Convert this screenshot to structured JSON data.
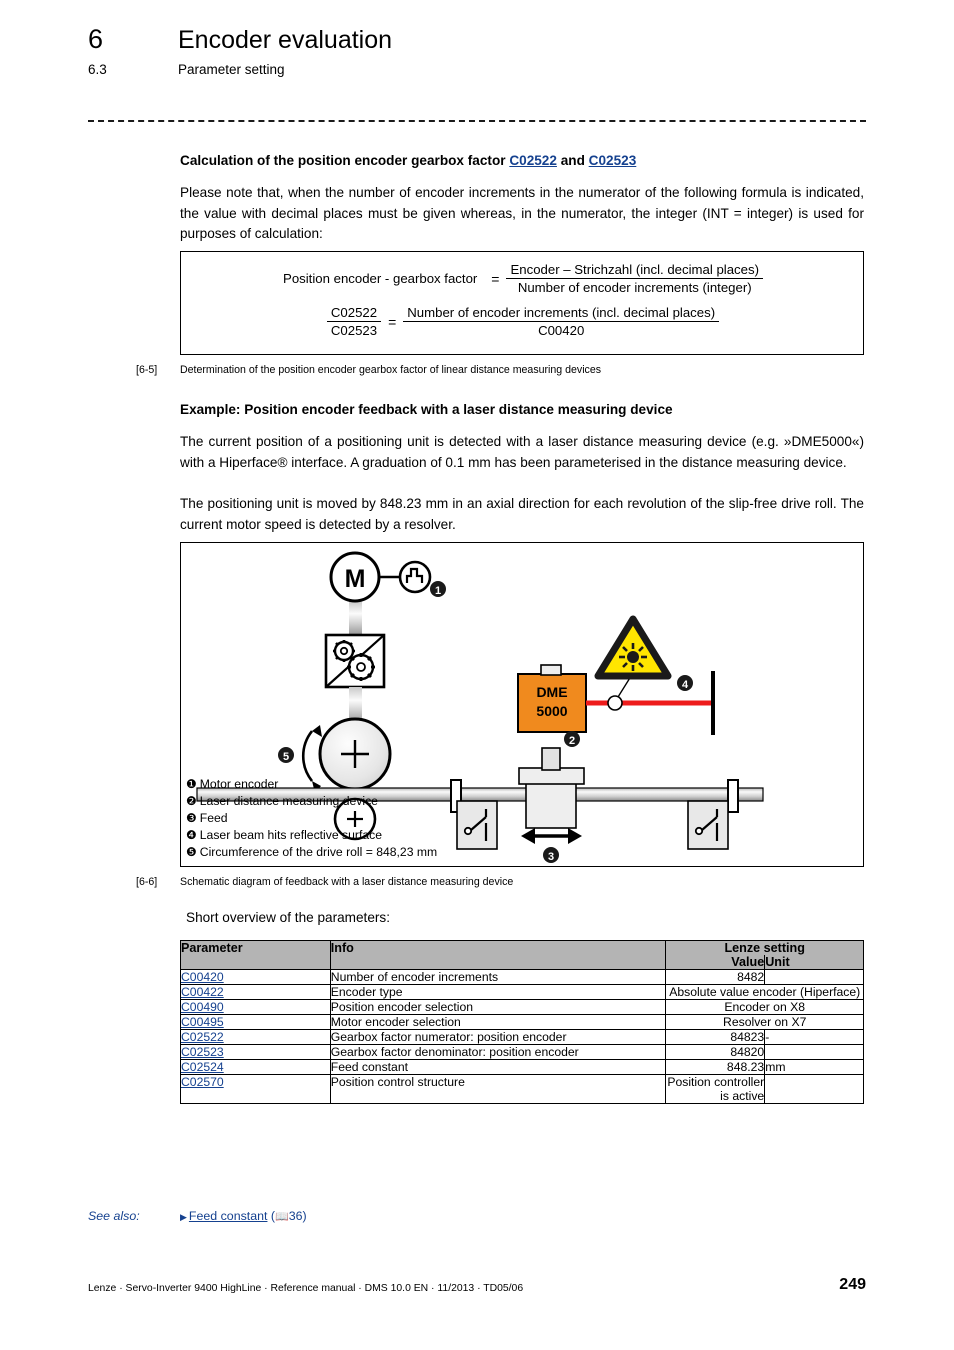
{
  "header": {
    "chapter_number": "6",
    "chapter_title": "Encoder evaluation",
    "section_number": "6.3",
    "section_title": "Parameter setting"
  },
  "section_heading": {
    "prefix": "Calculation of the position encoder gearbox factor ",
    "link1": "C02522",
    "middle": " and ",
    "link2": "C02523"
  },
  "intro_paragraph": "Please note that, when the number of encoder increments in the numerator of the following formula is indicated, the value with decimal places must be given whereas, in the numerator, the integer (INT = integer) is used for purposes of calculation:",
  "formula": {
    "line1_label": "Position encoder - gearbox factor",
    "line1_eq": "=",
    "line1_numerator": "Encoder – Strichzahl (incl. decimal places)",
    "line1_denominator": "Number of encoder increments (integer)",
    "line2_left_numerator": "C02522",
    "line2_left_denominator": "C02523",
    "line2_eq": "=",
    "line2_right_numerator": "Number of encoder increments (incl. decimal places)",
    "line2_right_denominator": "C00420"
  },
  "figure_6_5": {
    "number": "[6-5]",
    "caption": "Determination of the position encoder gearbox factor of linear distance measuring devices"
  },
  "example": {
    "heading": "Example: Position encoder feedback with a laser distance measuring device",
    "paragraph1": "The current position of a positioning unit is detected with a laser distance measuring device (e.g. »DME5000«) with a Hiperface® interface. A graduation of 0.1 mm has been parameterised in the distance measuring device.",
    "paragraph2": "The positioning unit is moved by 848.23 mm in an axial direction for each revolution of the slip-free drive roll. The current motor speed is detected by a resolver."
  },
  "diagram": {
    "motor_label": "M",
    "device_label_line1": "DME",
    "device_label_line2": "5000",
    "callouts": [
      "1",
      "2",
      "3",
      "4",
      "5"
    ],
    "colors": {
      "device_orange": "#f08a1e",
      "warning_yellow": "#ffe600",
      "laser_red": "#ee1c1c",
      "metal_grey": "#e8e8e8"
    }
  },
  "figure_6_6": {
    "number": "[6-6]",
    "caption": "Schematic diagram of feedback with a laser distance measuring device"
  },
  "legend": [
    {
      "bullet": "❶",
      "text": "Motor encoder"
    },
    {
      "bullet": "❷",
      "text": "Laser distance measuring device"
    },
    {
      "bullet": "❸",
      "text": "Feed"
    },
    {
      "bullet": "❹",
      "text": "Laser beam hits reflective surface"
    },
    {
      "bullet": "❺",
      "text": "Circumference of the drive roll = 848,23 mm"
    }
  ],
  "overview_label": "Short overview of the parameters:",
  "table": {
    "headers": {
      "parameter": "Parameter",
      "info": "Info",
      "lenze_setting": "Lenze setting",
      "value": "Value",
      "unit": "Unit"
    },
    "rows": [
      {
        "parameter": "C00420",
        "info": "Number of encoder increments",
        "value": "8482",
        "unit": "",
        "span": false
      },
      {
        "parameter": "C00422",
        "info": "Encoder type",
        "value": "Absolute value encoder (Hiperface)",
        "unit": "",
        "span": true
      },
      {
        "parameter": "C00490",
        "info": "Position encoder selection",
        "value": "Encoder on X8",
        "unit": "",
        "span": true
      },
      {
        "parameter": "C00495",
        "info": "Motor encoder selection",
        "value": "Resolver on X7",
        "unit": "",
        "span": true
      },
      {
        "parameter": "C02522",
        "info": "Gearbox factor numerator: position encoder",
        "value": "84823",
        "unit": "-",
        "span": false
      },
      {
        "parameter": "C02523",
        "info": "Gearbox factor denominator: position encoder",
        "value": "84820",
        "unit": "",
        "span": false
      },
      {
        "parameter": "C02524",
        "info": "Feed constant",
        "value": "848.23",
        "unit": "mm",
        "span": false
      },
      {
        "parameter": "C02570",
        "info": "Position control structure",
        "value": "Position controller is active",
        "unit": "",
        "span": false
      }
    ]
  },
  "see_also": {
    "label": "See also:",
    "arrow": "▶",
    "link_text": "Feed constant",
    "page_ref": "36",
    "book_icon": "📖"
  },
  "footer": {
    "text": "Lenze · Servo-Inverter 9400 HighLine · Reference manual · DMS 10.0 EN · 11/2013 · TD05/06",
    "page_number": "249"
  }
}
